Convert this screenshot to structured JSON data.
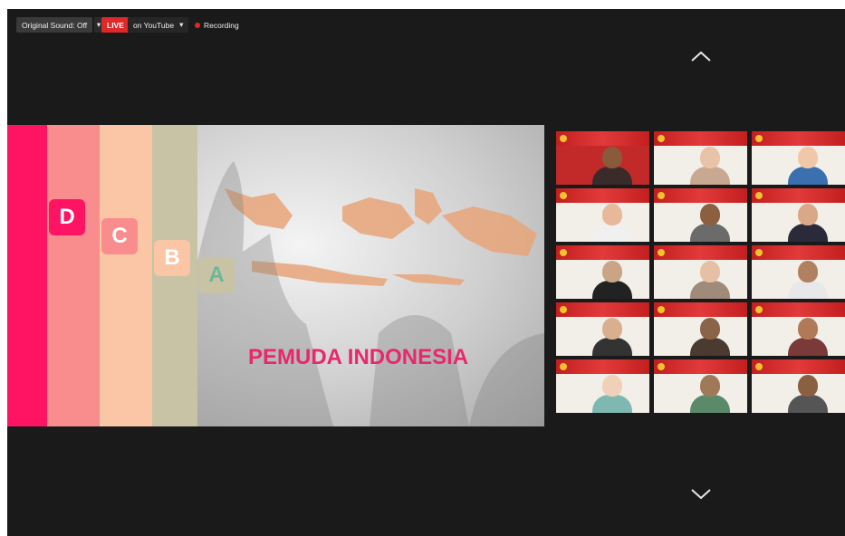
{
  "toolbar": {
    "original_sound": "Original Sound: Off",
    "live_badge": "LIVE",
    "live_target": "on YouTube",
    "recording": "Recording"
  },
  "slide": {
    "letters": [
      "D",
      "C",
      "B",
      "A"
    ],
    "title": "PEMUDA INDONESIA"
  },
  "colors": {
    "pink": "#ff1464",
    "salmon": "#f98c8c",
    "peach": "#fbc6a6",
    "sage": "#c9c3a5",
    "live_red": "#e02828",
    "active_tile": "#8fd14f"
  },
  "gallery": {
    "rows": 5,
    "cols": 3,
    "active_index": 0
  }
}
